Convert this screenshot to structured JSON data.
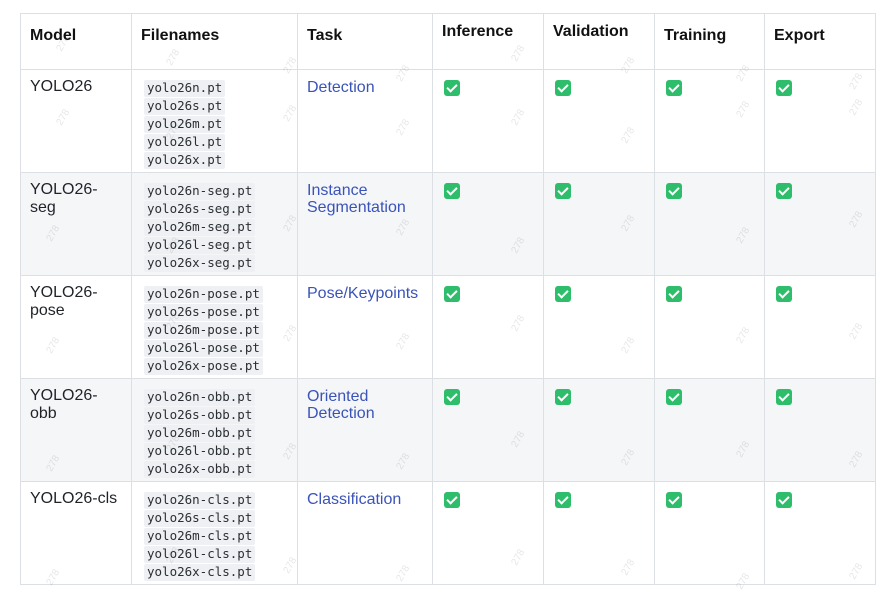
{
  "headers": {
    "model": "Model",
    "filenames": "Filenames",
    "task": "Task",
    "inference": "Inference",
    "validation": "Validation",
    "training": "Training",
    "export": "Export"
  },
  "rows": [
    {
      "model": "YOLO26",
      "files": [
        "yolo26n.pt",
        "yolo26s.pt",
        "yolo26m.pt",
        "yolo26l.pt",
        "yolo26x.pt"
      ],
      "task": "Detection",
      "inference": true,
      "validation": true,
      "training": true,
      "export": true
    },
    {
      "model": "YOLO26-seg",
      "files": [
        "yolo26n-seg.pt",
        "yolo26s-seg.pt",
        "yolo26m-seg.pt",
        "yolo26l-seg.pt",
        "yolo26x-seg.pt"
      ],
      "task": "Instance Segmentation",
      "inference": true,
      "validation": true,
      "training": true,
      "export": true
    },
    {
      "model": "YOLO26-pose",
      "files": [
        "yolo26n-pose.pt",
        "yolo26s-pose.pt",
        "yolo26m-pose.pt",
        "yolo26l-pose.pt",
        "yolo26x-pose.pt"
      ],
      "task": "Pose/Keypoints",
      "inference": true,
      "validation": true,
      "training": true,
      "export": true
    },
    {
      "model": "YOLO26-obb",
      "files": [
        "yolo26n-obb.pt",
        "yolo26s-obb.pt",
        "yolo26m-obb.pt",
        "yolo26l-obb.pt",
        "yolo26x-obb.pt"
      ],
      "task": "Oriented Detection",
      "inference": true,
      "validation": true,
      "training": true,
      "export": true
    },
    {
      "model": "YOLO26-cls",
      "files": [
        "yolo26n-cls.pt",
        "yolo26s-cls.pt",
        "yolo26m-cls.pt",
        "yolo26l-cls.pt",
        "yolo26x-cls.pt"
      ],
      "task": "Classification",
      "inference": true,
      "validation": true,
      "training": true,
      "export": true
    }
  ],
  "check_icon": "white-check-mark-icon",
  "colors": {
    "check_bg": "#2ebd6b",
    "link": "#3a53b8",
    "zebra": "#f5f6f8",
    "border": "#dcdfe4"
  },
  "watermark": "278"
}
